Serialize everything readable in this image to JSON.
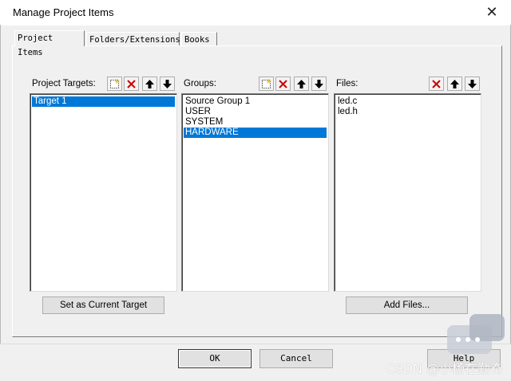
{
  "window": {
    "title": "Manage Project Items",
    "close_label": "✕"
  },
  "tabs": [
    {
      "label": "Project Items"
    },
    {
      "label": "Folders/Extensions"
    },
    {
      "label": "Books"
    }
  ],
  "targets": {
    "label": "Project Targets:",
    "items": [
      "Target 1"
    ],
    "selected_index": 0,
    "action_button": "Set as Current Target"
  },
  "groups": {
    "label": "Groups:",
    "items": [
      "Source Group 1",
      "USER",
      "SYSTEM",
      "HARDWARE"
    ],
    "selected_index": 3
  },
  "files": {
    "label": "Files:",
    "items": [
      "led.c",
      "led.h"
    ],
    "action_button": "Add Files..."
  },
  "footer": {
    "ok": "OK",
    "cancel": "Cancel",
    "help": "Help"
  },
  "watermark": "CSDN @小杨在勤奋",
  "colors": {
    "selection": "#0078d7",
    "delete": "#cc0000"
  },
  "icons": [
    "new-item-icon",
    "delete-icon",
    "move-up-icon",
    "move-down-icon",
    "close-icon",
    "chat-bubble-icon"
  ]
}
